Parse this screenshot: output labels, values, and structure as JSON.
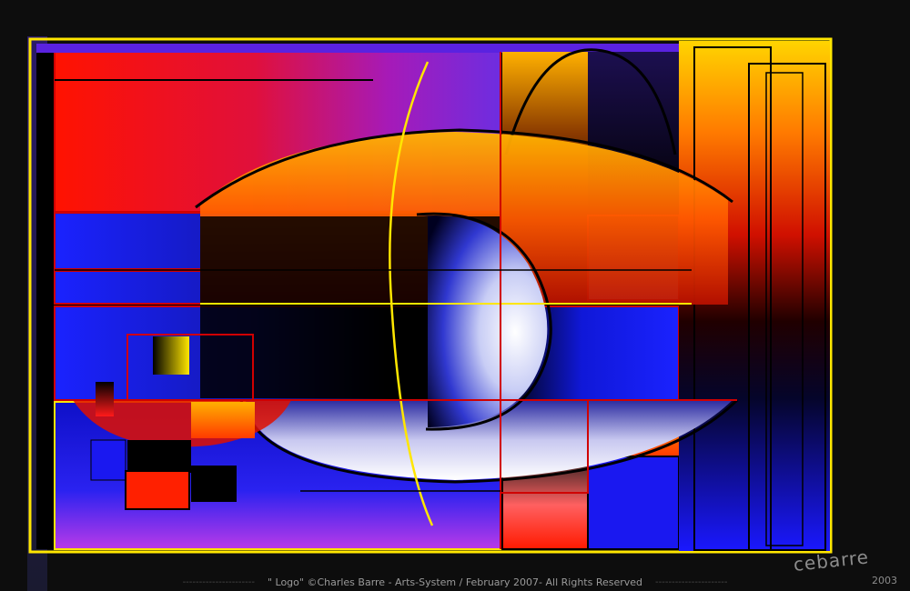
{
  "caption": {
    "text": "\" Logo\" ©Charles Barre - Arts-System / February 2007- All Rights Reserved",
    "dash_left": "----------------------",
    "dash_right": "----------------------"
  },
  "signature": {
    "name": "cebarre",
    "year": "2003"
  },
  "colors": {
    "background": "#0d0d0d",
    "frame_yellow": "#ffe600",
    "red": "#ff1a00",
    "violet": "#7a1fd1",
    "blue": "#1a18f0",
    "orange": "#ff8a00",
    "black": "#000000",
    "white": "#ffffff"
  }
}
